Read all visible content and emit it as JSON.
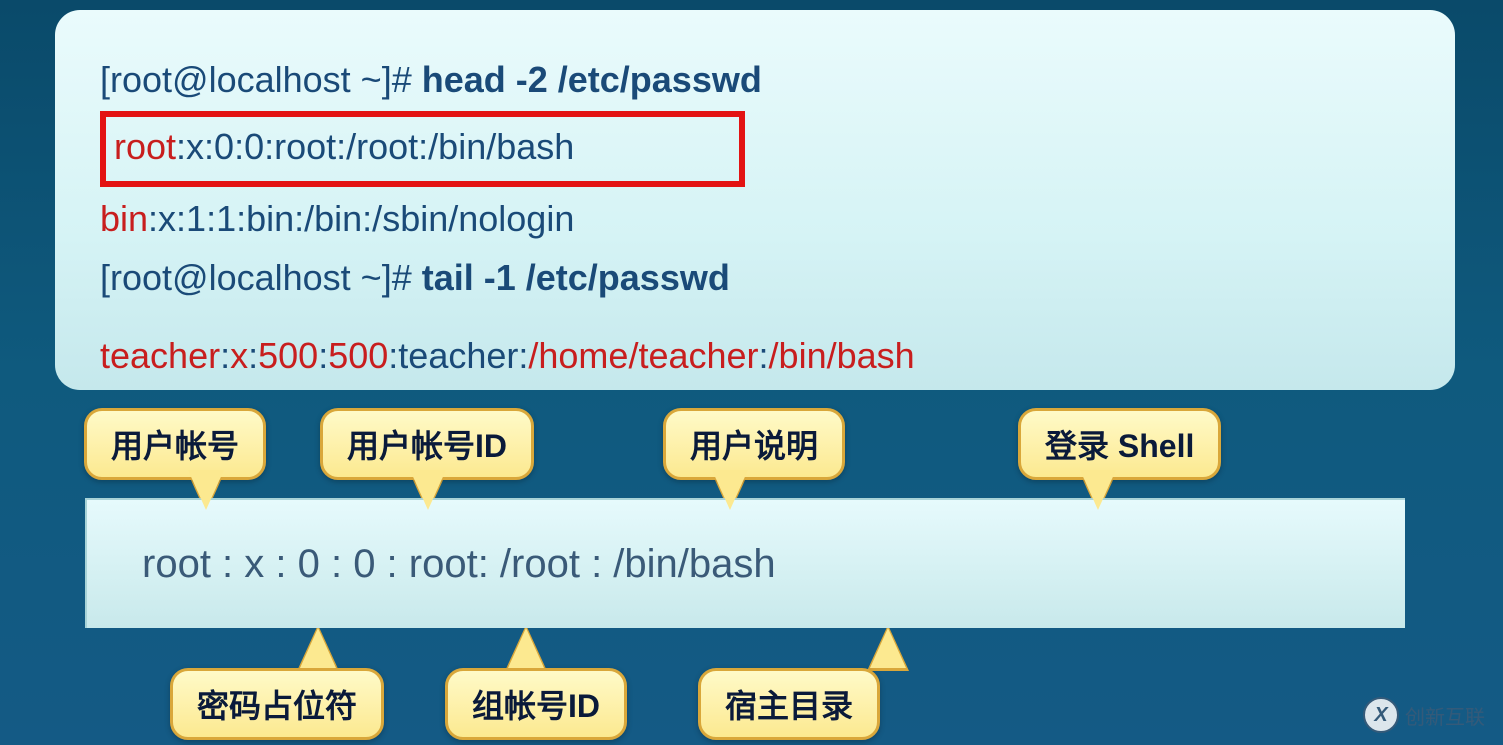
{
  "terminal": {
    "line1_prompt": "[root@localhost ~]# ",
    "line1_cmd": "head -2 /etc/passwd",
    "line2_user": "root",
    "line2_rest": ":x:0:0:root:/root:/bin/bash",
    "line3_user": "bin",
    "line3_rest": ":x:1:1:bin:/bin:/sbin/nologin",
    "line4_prompt": "[root@localhost ~]# ",
    "line4_cmd": "tail -1 /etc/passwd",
    "line5_user": "teacher",
    "line5_sep1": ":",
    "line5_x": "x",
    "line5_sep2": ":",
    "line5_uid": "500",
    "line5_sep3": ":",
    "line5_gid": "500",
    "line5_sep4": ":",
    "line5_gecos": "teacher",
    "line5_sep5": ":",
    "line5_home": "/home/teacher",
    "line5_sep6": ":",
    "line5_shell": "/bin/bash"
  },
  "breakdown": {
    "text": "root  :  x  :  0  :  0  :  root:   /root  :  /bin/bash"
  },
  "labels": {
    "username": "用户帐号",
    "uid": "用户帐号ID",
    "gecos": "用户说明",
    "shell": "登录 Shell",
    "password": "密码占位符",
    "gid": "组帐号ID",
    "home": "宿主目录"
  },
  "watermark": {
    "text": "创新互联"
  }
}
